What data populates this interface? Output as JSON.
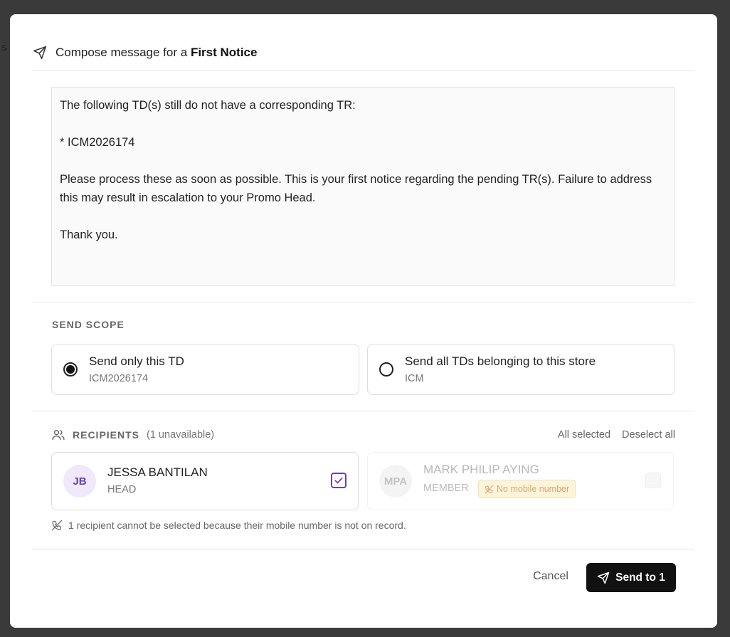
{
  "backdrop": {
    "fragment": "s"
  },
  "dialog": {
    "title_prefix": "Compose message for a",
    "title_notice": "First Notice"
  },
  "message": {
    "body": "The following TD(s) still do not have a corresponding TR:\n\n* ICM2026174\n\nPlease process these as soon as possible. This is your first notice regarding the pending TR(s). Failure to address this may result in escalation to your Promo Head.\n\nThank you."
  },
  "send_scope": {
    "label": "SEND SCOPE",
    "options": [
      {
        "title": "Send only this TD",
        "subtitle": "ICM2026174",
        "selected": true
      },
      {
        "title": "Send all TDs belonging to this store",
        "subtitle": "ICM",
        "selected": false
      }
    ]
  },
  "recipients": {
    "label": "RECIPIENTS",
    "unavailable_count": "(1 unavailable)",
    "all_selected_label": "All selected",
    "deselect_all_label": "Deselect all",
    "items": [
      {
        "initials": "JB",
        "name": "JESSA BANTILAN",
        "role": "HEAD",
        "checked": true,
        "available": true
      },
      {
        "initials": "MPA",
        "name": "MARK PHILIP AYING",
        "role": "MEMBER",
        "checked": false,
        "available": false,
        "badge": "No mobile number"
      }
    ],
    "note": "1 recipient cannot be selected because their mobile number is not on record."
  },
  "footer": {
    "cancel_label": "Cancel",
    "send_label": "Send to 1"
  },
  "colors": {
    "accent_purple": "#6a3fb8",
    "badge_bg": "#fdf4dc",
    "badge_text": "#d9a66a",
    "primary_button": "#111111"
  },
  "icons": [
    "send-icon",
    "users-icon",
    "no-phone-icon",
    "check-icon"
  ]
}
